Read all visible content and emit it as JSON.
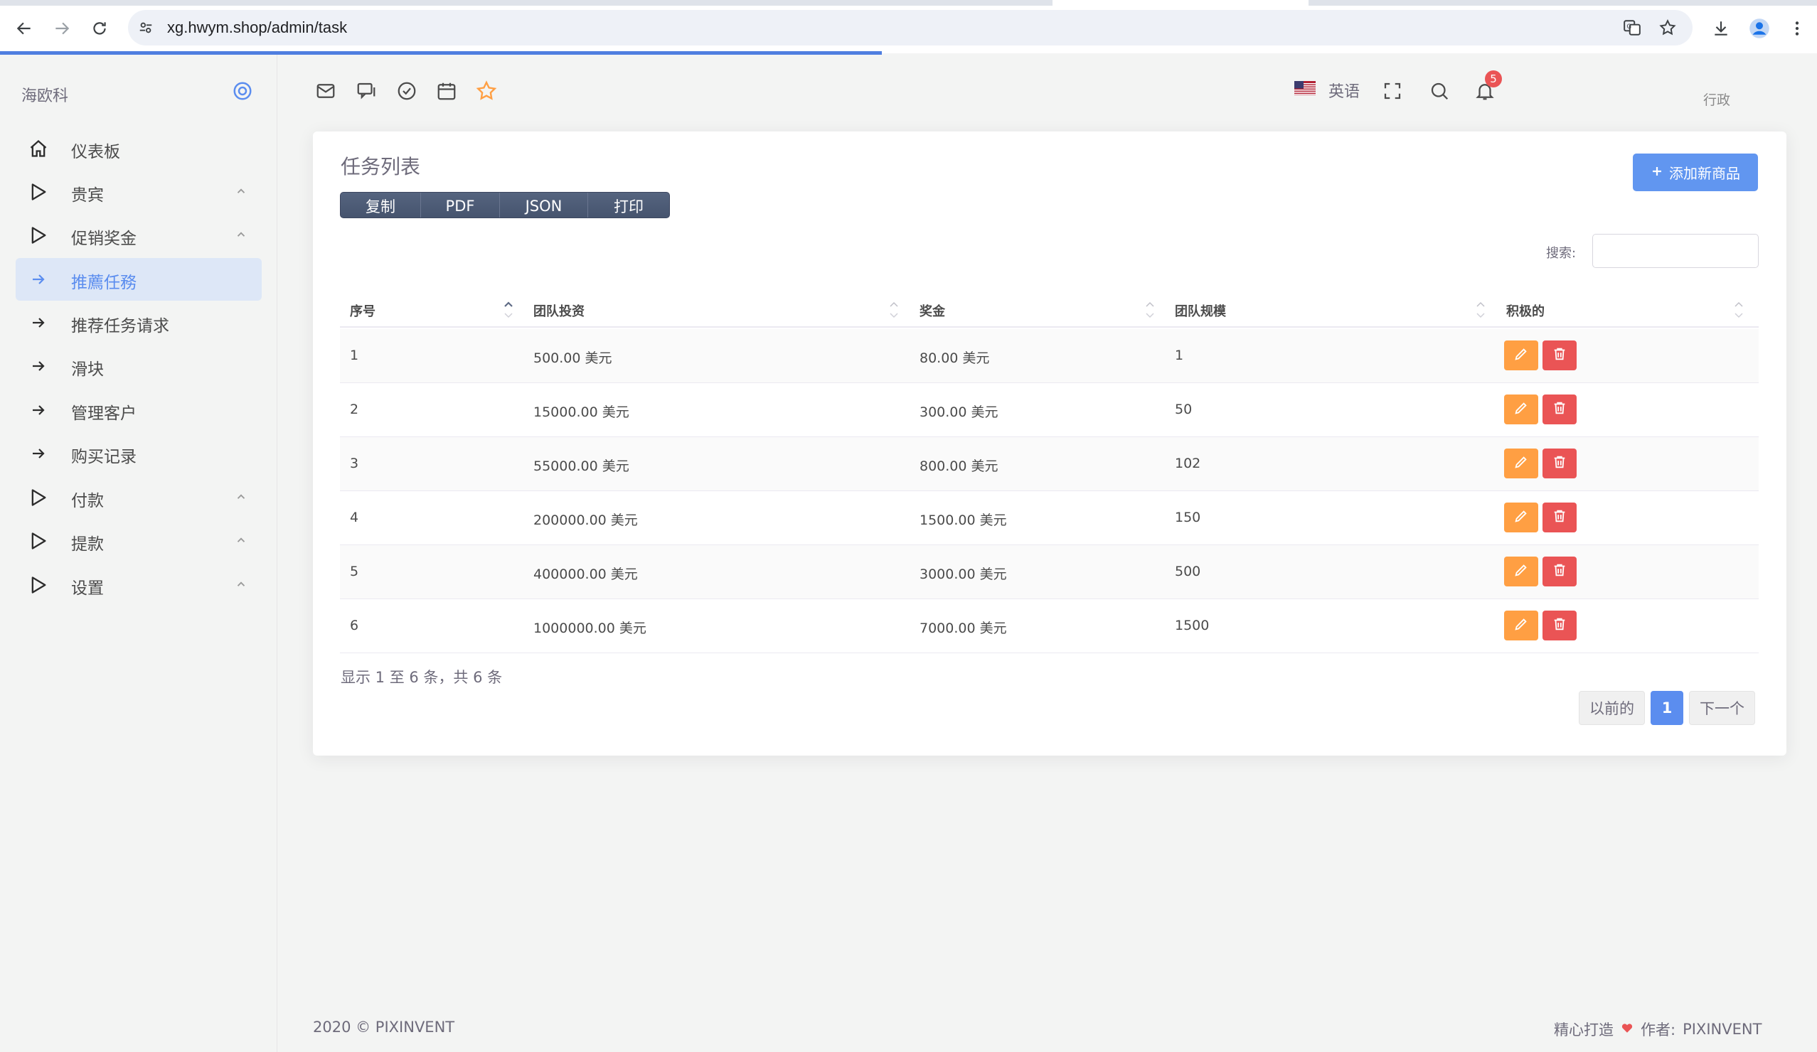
{
  "browser": {
    "url": "xg.hwym.shop/admin/task"
  },
  "sidebar": {
    "brand": "海欧科",
    "items": [
      {
        "label": "仪表板",
        "icon": "home-icon"
      },
      {
        "label": "贵宾",
        "icon": "play-icon"
      },
      {
        "label": "促销奖金",
        "icon": "play-icon"
      },
      {
        "label": "推薦任務",
        "icon": "arrow-right-icon",
        "active": true
      },
      {
        "label": "推荐任务请求",
        "icon": "arrow-right-icon"
      },
      {
        "label": "滑块",
        "icon": "arrow-right-icon"
      },
      {
        "label": "管理客户",
        "icon": "arrow-right-icon"
      },
      {
        "label": "购买记录",
        "icon": "arrow-right-icon"
      },
      {
        "label": "付款",
        "icon": "play-icon"
      },
      {
        "label": "提款",
        "icon": "play-icon"
      },
      {
        "label": "设置",
        "icon": "play-icon"
      }
    ]
  },
  "topnav": {
    "language": "英语",
    "notification_count": "5",
    "user_role": "行政"
  },
  "card": {
    "title": "任务列表",
    "add_button": "添加新商品",
    "export_buttons": [
      "复制",
      "PDF",
      "JSON",
      "打印"
    ],
    "search_label": "搜索:",
    "search_value": ""
  },
  "table": {
    "columns": [
      "序号",
      "团队投资",
      "奖金",
      "团队规模",
      "积极的"
    ],
    "rows": [
      {
        "id": "1",
        "investment": "500.00 美元",
        "bonus": "80.00 美元",
        "size": "1"
      },
      {
        "id": "2",
        "investment": "15000.00 美元",
        "bonus": "300.00 美元",
        "size": "50"
      },
      {
        "id": "3",
        "investment": "55000.00 美元",
        "bonus": "800.00 美元",
        "size": "102"
      },
      {
        "id": "4",
        "investment": "200000.00 美元",
        "bonus": "1500.00 美元",
        "size": "150"
      },
      {
        "id": "5",
        "investment": "400000.00 美元",
        "bonus": "3000.00 美元",
        "size": "500"
      },
      {
        "id": "6",
        "investment": "1000000.00 美元",
        "bonus": "7000.00 美元",
        "size": "1500"
      }
    ]
  },
  "pagination": {
    "info": "显示 1 至 6 条，共 6 条",
    "prev": "以前的",
    "current": "1",
    "next": "下一个"
  },
  "footer": {
    "copyright": "2020 © PIXINVENT",
    "made_with": "精心打造",
    "by": "作者:",
    "author": "PIXINVENT"
  },
  "colors": {
    "primary": "#5b8def",
    "warning": "#ff9f43",
    "danger": "#ea5455"
  }
}
